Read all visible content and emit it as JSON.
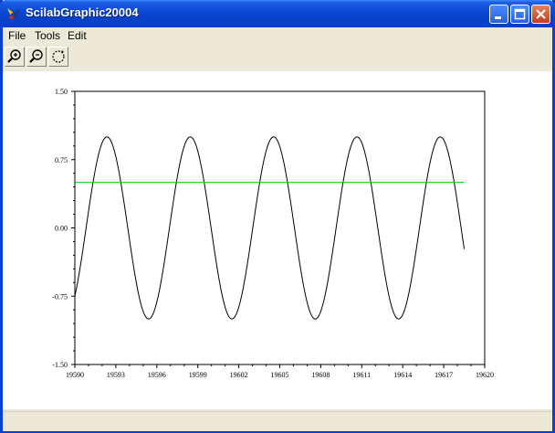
{
  "window": {
    "title": "ScilabGraphic20004",
    "title_bar_color": "#0a49d6"
  },
  "title_buttons": [
    {
      "icon": "minimize-icon"
    },
    {
      "icon": "maximize-icon"
    },
    {
      "icon": "close-icon"
    }
  ],
  "menu": {
    "items": [
      {
        "label": "File"
      },
      {
        "label": "Tools"
      },
      {
        "label": "Edit"
      }
    ]
  },
  "toolbar": {
    "buttons": [
      {
        "icon": "zoom-in-icon"
      },
      {
        "icon": "zoom-out-icon"
      },
      {
        "icon": "rotate-icon"
      }
    ]
  },
  "chart_data": {
    "type": "line",
    "title": "",
    "xlabel": "",
    "ylabel": "",
    "xlim": [
      19590,
      19620
    ],
    "ylim": [
      -1.5,
      1.5
    ],
    "x_ticks": [
      "19590",
      "19593",
      "19596",
      "19599",
      "19602",
      "19605",
      "19608",
      "19611",
      "19614",
      "19617",
      "19620"
    ],
    "y_ticks": [
      "1.50",
      "0.75",
      "0.00",
      "-0.75",
      "-1.50"
    ],
    "grid": false,
    "series": [
      {
        "color": "#000000",
        "function": "sine",
        "amplitude": 1.0,
        "period": 6.1,
        "x_range": [
          19590,
          19618.5
        ],
        "y_at_start": -0.75,
        "peaks_x": [
          19592.6,
          19598.7,
          19604.8,
          19610.9,
          19617.0
        ],
        "troughs_x": [
          19595.6,
          19601.7,
          19607.8,
          19613.9
        ]
      },
      {
        "color": "#00cc00",
        "function": "constant",
        "y": 0.5,
        "x_range": [
          19590,
          19618.5
        ]
      }
    ]
  }
}
